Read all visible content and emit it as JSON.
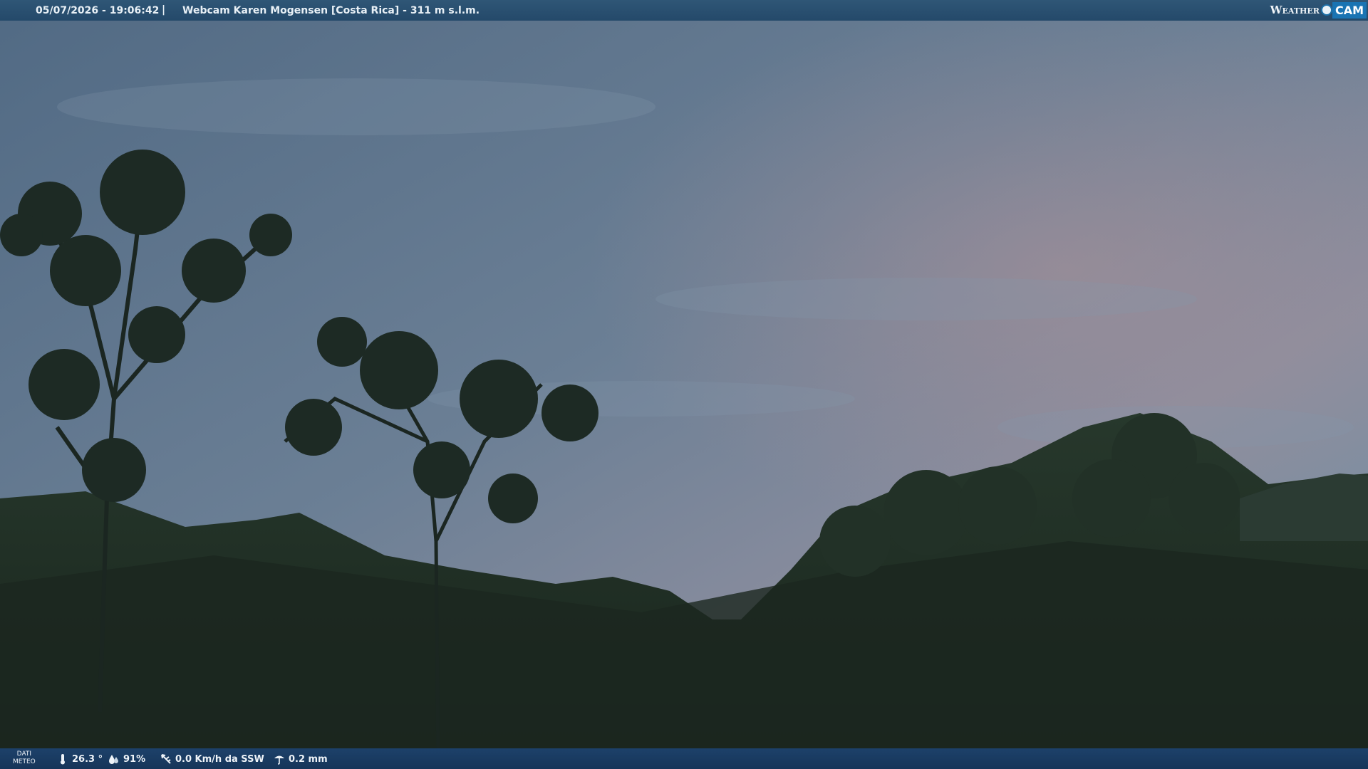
{
  "header": {
    "datetime": "05/07/2026 - 19:06:42",
    "separator": "|",
    "title": "Webcam Karen Mogensen [Costa Rica]  - 311 m s.l.m."
  },
  "logo": {
    "word": "Weather",
    "cam": "CAM"
  },
  "footer": {
    "dati_line1": "DATI",
    "dati_line2": "METEO",
    "temperature": "26.3 °",
    "humidity": "91%",
    "wind": "0.0 Km/h da SSW",
    "rain": "0.2 mm"
  },
  "icons": {
    "temperature": "thermometer-icon",
    "humidity": "humidity-drops-icon",
    "wind": "wind-vane-icon",
    "rain": "rain-gauge-icon"
  },
  "colors": {
    "topbar": "#24496a",
    "bottombar": "#163559",
    "sky": "#4f6a82",
    "vegetation": "#1f2d24"
  }
}
